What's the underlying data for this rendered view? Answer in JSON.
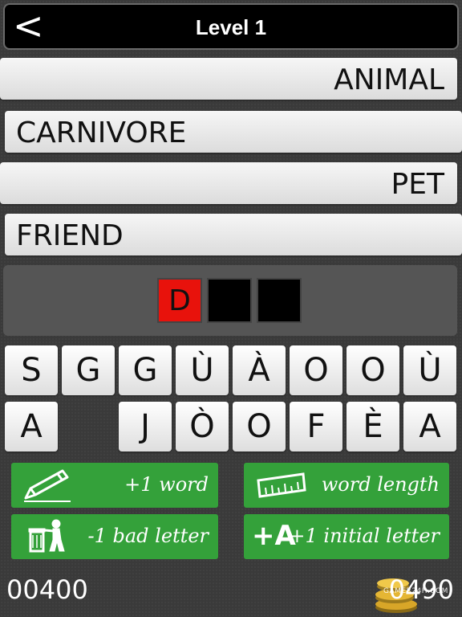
{
  "header": {
    "back_label": "<",
    "title": "Level 1"
  },
  "clues": [
    {
      "text": "ANIMAL",
      "align": "right"
    },
    {
      "text": "CARNIVORE",
      "align": "left"
    },
    {
      "text": "PET",
      "align": "right"
    },
    {
      "text": "FRIEND",
      "align": "left"
    }
  ],
  "answer": {
    "slots": [
      "D",
      "",
      ""
    ]
  },
  "keyboard": {
    "row1": [
      "S",
      "G",
      "G",
      "Ù",
      "À",
      "O",
      "O",
      "Ù"
    ],
    "row2": [
      "A",
      "J",
      "Ò",
      "O",
      "F",
      "È",
      "A"
    ]
  },
  "powerups": {
    "plus_word": "+1 word",
    "word_length": "word length",
    "bad_letter": "-1 bad letter",
    "initial_letter": "+1 initial letter",
    "initial_icon_text": "+A"
  },
  "score": "00400",
  "coins": "0490",
  "watermark": "GAMER24H.COM",
  "colors": {
    "green": "#34a13a",
    "red_slot": "#e8120c"
  }
}
